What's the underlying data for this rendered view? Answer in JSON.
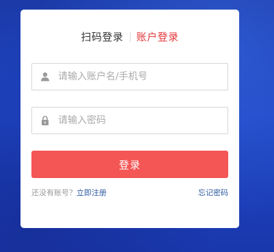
{
  "tabs": {
    "qr_login": "扫码登录",
    "account_login": "账户登录"
  },
  "fields": {
    "username_placeholder": "请输入账户名/手机号",
    "password_placeholder": "请输入密码",
    "username_icon": "user-icon",
    "password_icon": "lock-icon"
  },
  "login_button": "登录",
  "footer": {
    "no_account_text": "还没有账号？",
    "register_link": "立即注册",
    "forgot_link": "忘记密码"
  },
  "colors": {
    "active_tab": "#e4393c",
    "button": "#f45655",
    "link": "#2d5aa0",
    "background": "#1e45c4"
  }
}
